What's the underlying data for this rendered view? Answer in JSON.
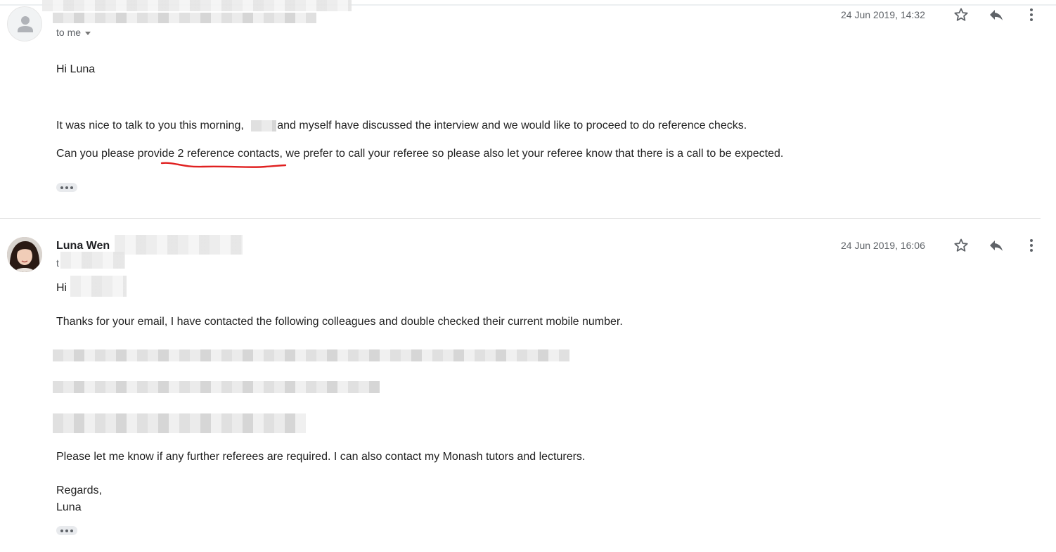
{
  "messages": [
    {
      "sender": "",
      "to_label": "to me",
      "date": "24 Jun 2019, 14:32",
      "greeting": "Hi Luna",
      "para1_before": "It was nice to talk to you this morning,",
      "para1_after": "and myself have discussed the interview and we would like to proceed to do reference checks.",
      "para2": "Can you please provide 2 reference contacts, we prefer to call your referee so please also let your referee know that there is a call to be expected.",
      "avatar_icon": "person-icon"
    },
    {
      "sender": "Luna Wen",
      "to_label": "t",
      "date": "24 Jun 2019, 16:06",
      "greeting": "Hi",
      "para1": "Thanks for your email, I have contacted the following colleagues and double checked their current mobile number.",
      "para2": "Please let me know if any further referees are required. I can also contact my Monash tutors and lecturers.",
      "signoff": "Regards,",
      "signature": "Luna"
    }
  ],
  "icons": [
    "star-icon",
    "reply-icon",
    "more-vert-icon",
    "ellipsis-icon"
  ],
  "colors": {
    "annotation_red": "#e02020",
    "icon_gray": "#5f6368"
  }
}
